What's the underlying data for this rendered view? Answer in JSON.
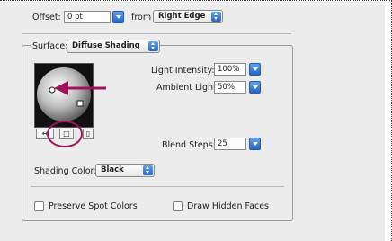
{
  "offset": {
    "label": "Offset:",
    "value": "0 pt",
    "from_label": "from",
    "from_value": "Right Edge"
  },
  "surface": {
    "label": "Surface:",
    "value": "Diffuse Shading",
    "light_intensity": {
      "label": "Light Intensity:",
      "value": "100%"
    },
    "ambient_light": {
      "label": "Ambient Light:",
      "value": "50%"
    },
    "blend_steps": {
      "label": "Blend Steps:",
      "value": "25"
    },
    "shading_color": {
      "label": "Shading Color:",
      "value": "Black"
    },
    "light_tools": {
      "move_back": "↔",
      "new_light": "□",
      "delete": "▯"
    }
  },
  "options": {
    "preserve_spot_colors": "Preserve Spot Colors",
    "draw_hidden_faces": "Draw Hidden Faces"
  },
  "colors": {
    "annotation": "#a0125a",
    "accent": "#2566c7"
  },
  "icons": [
    "arrow-down-icon",
    "popup-arrows-icon",
    "light-sphere-preview",
    "checkbox-icon"
  ]
}
